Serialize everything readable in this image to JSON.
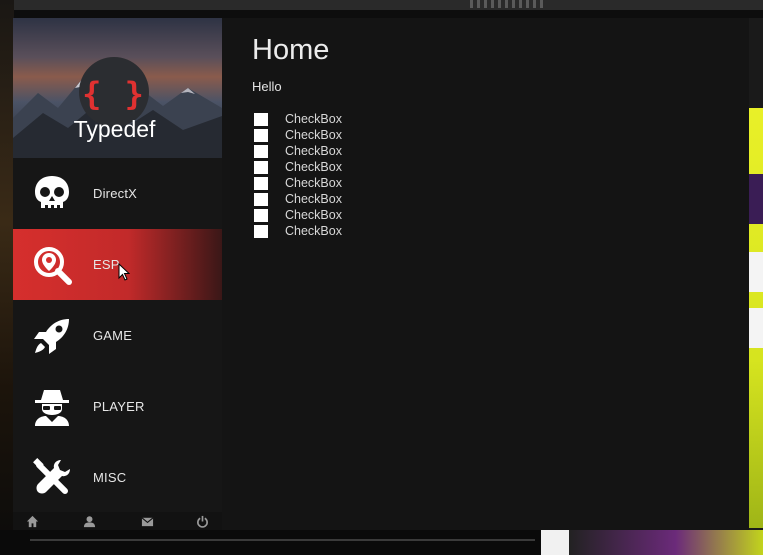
{
  "app": {
    "brand": "Typedef",
    "logo_glyph": "{ }",
    "accent_color": "#d62f2d"
  },
  "sidebar": {
    "items": [
      {
        "label": "DirectX",
        "icon": "skull-icon",
        "active": false
      },
      {
        "label": "ESP",
        "icon": "search-location-icon",
        "active": true
      },
      {
        "label": "GAME",
        "icon": "rocket-icon",
        "active": false
      },
      {
        "label": "PLAYER",
        "icon": "spy-icon",
        "active": false
      },
      {
        "label": "MISC",
        "icon": "tools-icon",
        "active": false
      }
    ],
    "footer_icons": [
      "home-icon",
      "user-icon",
      "envelope-icon",
      "power-icon"
    ]
  },
  "main": {
    "title": "Home",
    "greeting": "Hello",
    "checkboxes": [
      {
        "label": "CheckBox",
        "checked": false
      },
      {
        "label": "CheckBox",
        "checked": false
      },
      {
        "label": "CheckBox",
        "checked": false
      },
      {
        "label": "CheckBox",
        "checked": false
      },
      {
        "label": "CheckBox",
        "checked": false
      },
      {
        "label": "CheckBox",
        "checked": false
      },
      {
        "label": "CheckBox",
        "checked": false
      },
      {
        "label": "CheckBox",
        "checked": false
      }
    ]
  }
}
